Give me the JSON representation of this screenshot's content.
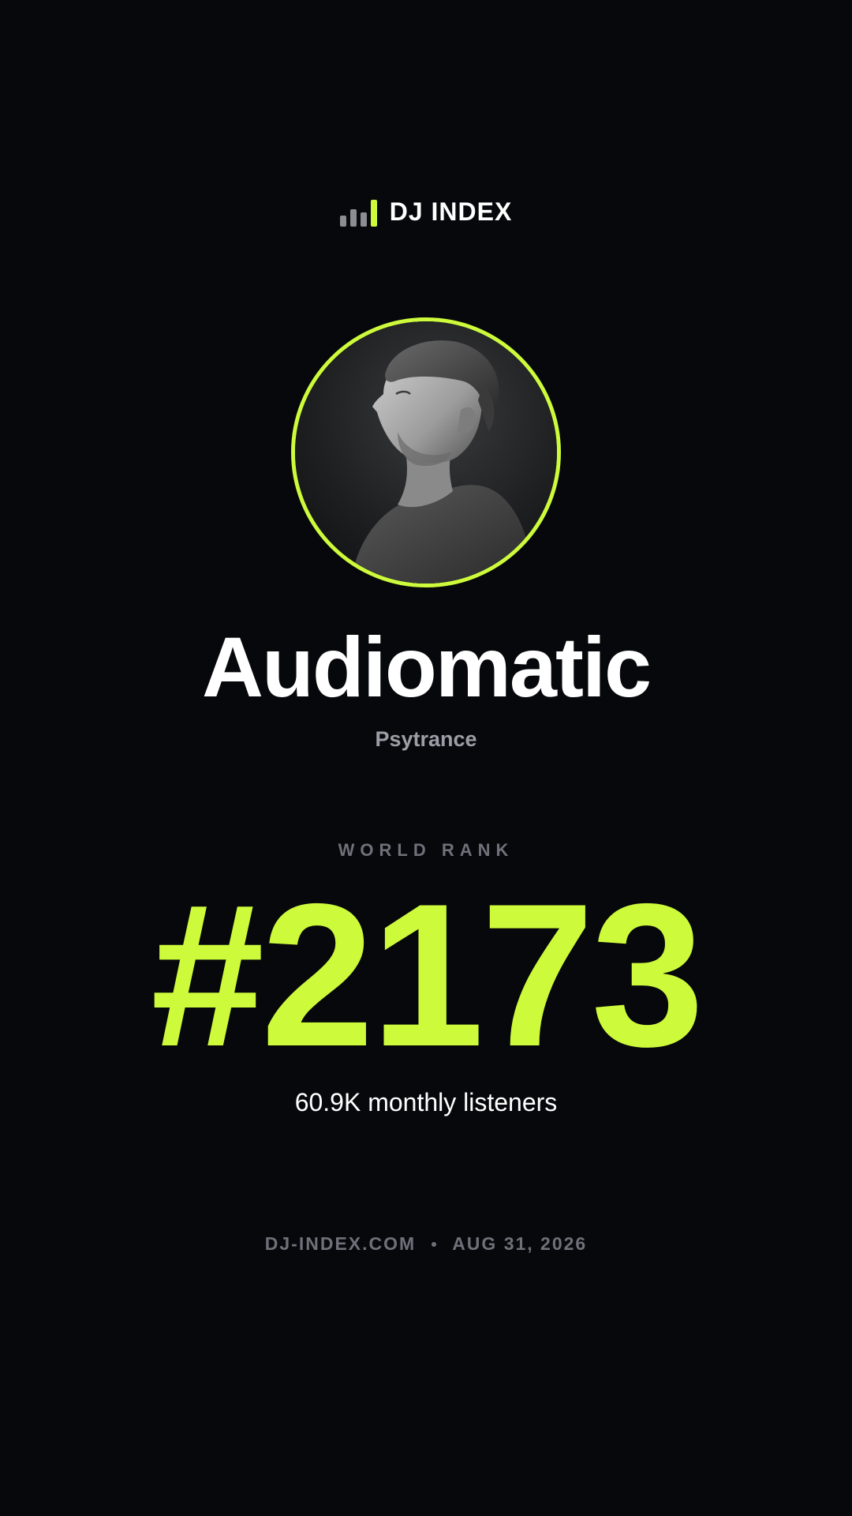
{
  "brand": {
    "title": "DJ INDEX",
    "icon": "bar-chart-icon",
    "bar_colors": [
      "#8b8d93",
      "#8b8d93",
      "#8b8d93",
      "#cdfb3b"
    ]
  },
  "artist": {
    "name": "Audiomatic",
    "genre": "Psytrance",
    "photo": "artist-portrait"
  },
  "rank": {
    "label": "WORLD RANK",
    "value": "#2173",
    "listeners": "60.9K monthly listeners"
  },
  "footer": {
    "site": "DJ-INDEX.COM",
    "separator_icon": "dot-icon",
    "date": "AUG 31, 2026"
  },
  "colors": {
    "background": "#07080b",
    "accent": "#cdfb3b",
    "muted": "#6e717a",
    "genre": "#9b9ea6",
    "text": "#ffffff"
  }
}
